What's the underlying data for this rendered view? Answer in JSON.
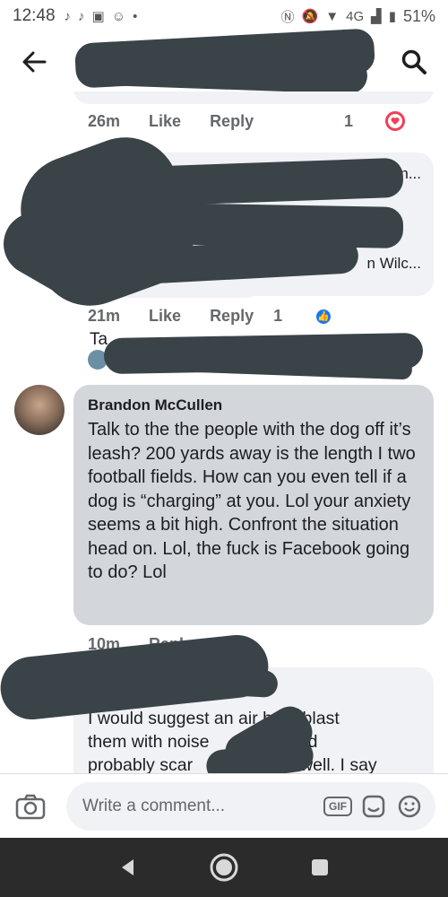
{
  "status_bar": {
    "time": "12:48",
    "network": "4G",
    "battery": "51%"
  },
  "header": {
    "back_icon": "arrow-left-icon",
    "search_icon": "search-icon"
  },
  "comments": [
    {
      "meta": {
        "time": "26m",
        "like": "Like",
        "reply": "Reply",
        "reaction_count": "1",
        "reaction_type": "love"
      }
    },
    {
      "visible_fragment": "Ta",
      "visible_fragment_2": "ahn...",
      "visible_fragment_3": "n Wilc...",
      "meta": {
        "time": "21m",
        "like": "Like",
        "reply": "Reply",
        "reaction_count": "1",
        "reaction_type": "like"
      }
    },
    {
      "name": "Brandon McCullen",
      "text": "Talk to the the people with the dog off it’s leash? 200 yards away is the length I two football fields. How can you even tell if a dog is “charging” at you. Lol your anxiety seems a bit high. Confront the situation head on. Lol, the fuck is Facebook going to do? Lol",
      "meta": {
        "time": "10m",
        "reply": "Reply"
      }
    },
    {
      "text_lines": [
        "I would suggest an air horn blast",
        "them with noise",
        "would",
        "probably scar",
        "well. I say"
      ]
    }
  ],
  "composer": {
    "placeholder": "Write a comment...",
    "gif_label": "GIF"
  },
  "colors": {
    "accent": "#1877f2",
    "love": "#f33e58",
    "bubble": "#f0f2f5",
    "redaction": "#3a4348",
    "nav": "#2b2b2b"
  }
}
